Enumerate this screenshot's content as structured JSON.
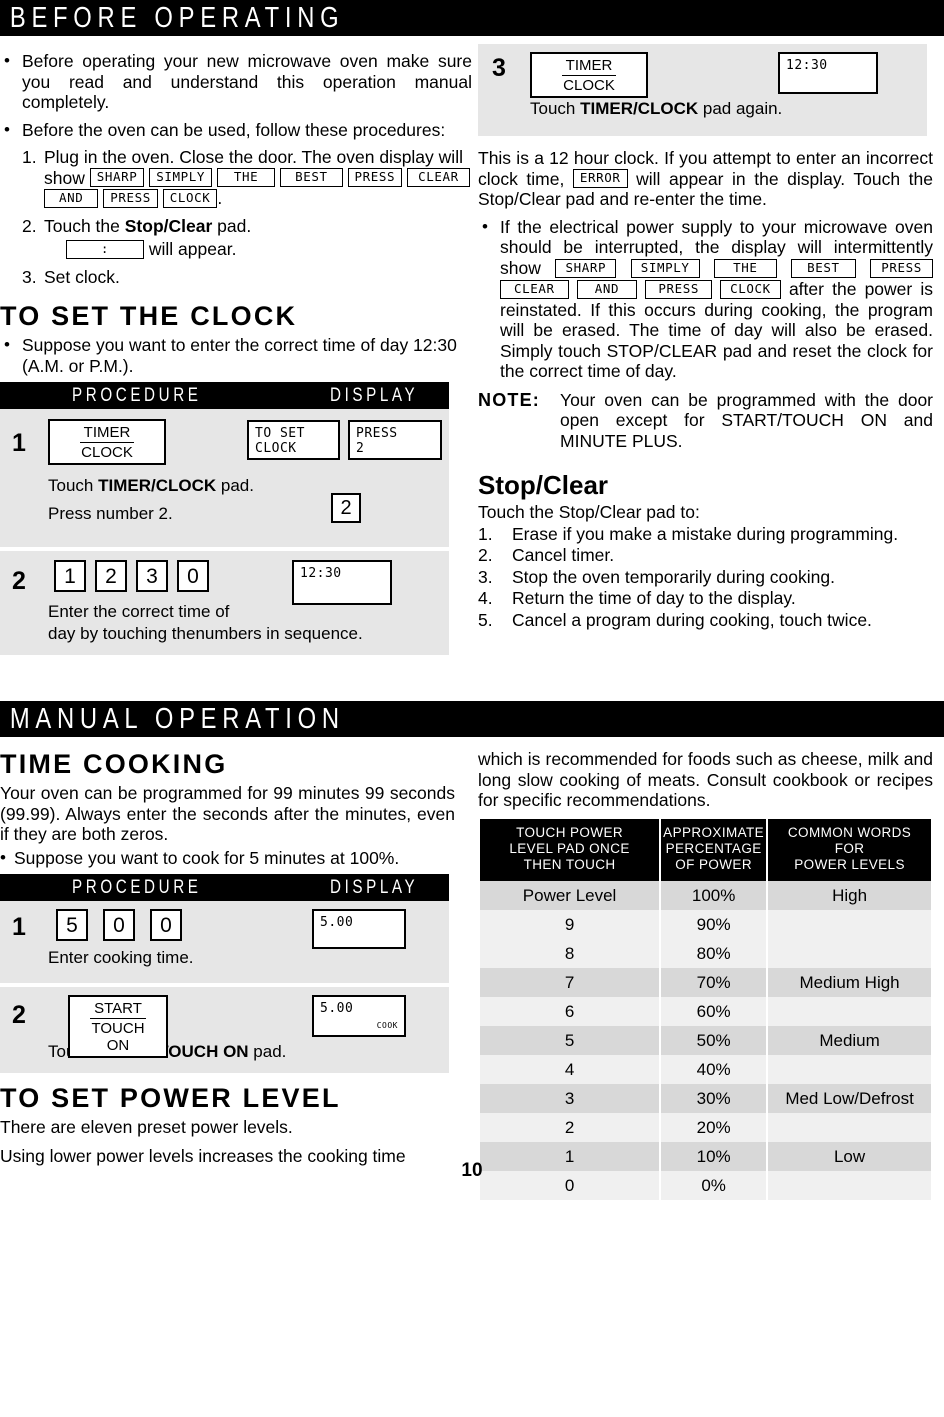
{
  "page": {
    "number": "10"
  },
  "sections": {
    "before_operating": {
      "banner": "BEFORE OPERATING"
    },
    "manual_operation": {
      "banner": "MANUAL OPERATION"
    }
  },
  "left": {
    "bullet1": "Before operating your new microwave oven make sure you read and understand this operation manual completely.",
    "bullet2": "Before the oven can be used, follow these procedures:",
    "step1_pre": "1.",
    "step1_a": "Plug in the oven. Close the door. The oven display",
    "step1_b": "will show",
    "step1_lcds": [
      "SHARP",
      "SIMPLY",
      "THE",
      "BEST",
      "PRESS",
      "CLEAR",
      "AND",
      "PRESS",
      "CLOCK"
    ],
    "step1_end": ".",
    "step2_n": "2.",
    "step2_a_pre": "Touch the ",
    "step2_a_bold": "Stop/Clear",
    "step2_a_post": " pad.",
    "step2_lcd": ":",
    "step2_b": "will appear.",
    "step3_n": "3.",
    "step3_t": "Set clock.",
    "clock_heading": "TO SET THE CLOCK",
    "clock_bullet": "Suppose you want to enter the correct time of day 12:30 (A.M. or P.M.).",
    "proc_header": {
      "procedure": "PROCEDURE",
      "display": "DISPLAY"
    },
    "clock_steps": [
      {
        "no": "1",
        "pad_top": "TIMER",
        "pad_bot": "CLOCK",
        "disp1_l1": "TO SET",
        "disp1_l2": "CLOCK",
        "disp2_l1": "PRESS",
        "disp2_l2": "2",
        "caption1_pre": "Touch ",
        "caption1_bold": "TIMER/CLOCK",
        "caption1_post": " pad.",
        "caption2": "Press number 2.",
        "numpad": "2"
      },
      {
        "no": "2",
        "keys": [
          "1",
          "2",
          "3",
          "0"
        ],
        "display": "12:30",
        "caption1": "Enter the correct time of",
        "caption2": "day by touching thenumbers in sequence."
      }
    ],
    "time_cooking_heading": "TIME COOKING",
    "time_cooking_p": "Your oven can be programmed for 99 minutes 99 seconds (99.99). Always enter the seconds after the minutes, even if they are both zeros.",
    "time_cooking_bullet": "Suppose you want to cook for 5 minutes at 100%.",
    "cook_steps": [
      {
        "no": "1",
        "keys": [
          "5",
          "0",
          "0"
        ],
        "display": "5.00",
        "caption": "Enter cooking time."
      },
      {
        "no": "2",
        "pad_top": "START",
        "pad_bot": "TOUCH ON",
        "display": "5.00",
        "display_sub": "COOK",
        "caption_pre": "Touch ",
        "caption_bold": "START/TOUCH ON",
        "caption_post": " pad."
      }
    ],
    "power_heading": "TO SET POWER LEVEL",
    "power_p1": "There are eleven preset power levels.",
    "power_p2": "Using lower power levels increases the cooking time"
  },
  "right": {
    "clock_step3": {
      "no": "3",
      "pad_top": "TIMER",
      "pad_bot": "CLOCK",
      "display": "12:30",
      "caption_pre": "Touch ",
      "caption_bold": "TIMER/CLOCK",
      "caption_post": " pad again."
    },
    "para1_a": "This is a 12 hour clock. If you attempt to enter an incorrect clock time,",
    "para1_lcd": "ERROR",
    "para1_b": "will appear in the display. Touch the Stop/Clear pad and re-enter the time.",
    "bullet_a": "If the electrical power supply to your microwave oven should be interrupted, the display will intermittently show",
    "bullet_lcds": [
      "SHARP",
      "SIMPLY",
      "THE",
      "BEST",
      "PRESS",
      "CLEAR",
      "AND",
      "PRESS",
      "CLOCK"
    ],
    "bullet_b": "after the power is reinstated. If this occurs during cooking, the program will be erased. The time of day will also be erased. Simply touch STOP/CLEAR pad and reset the clock for the correct time of day.",
    "note_label": "NOTE:",
    "note_body": "Your oven can be programmed with the door open except for START/TOUCH ON and MINUTE PLUS.",
    "stop_clear_heading": "Stop/Clear",
    "stop_clear_intro": "Touch the Stop/Clear pad to:",
    "stop_clear_items": [
      {
        "n": "1.",
        "t": "Erase if you make a mistake during programming."
      },
      {
        "n": "2.",
        "t": "Cancel timer."
      },
      {
        "n": "3.",
        "t": "Stop the oven temporarily during cooking."
      },
      {
        "n": "4.",
        "t": "Return the time of day to the display."
      },
      {
        "n": "5.",
        "t": "Cancel a program during cooking, touch twice."
      }
    ],
    "manual_intro": "which is recommended for foods such as cheese, milk and long slow cooking of meats. Consult cookbook or recipes for specific recommendations.",
    "power_table": {
      "headers": [
        "TOUCH POWER\nLEVEL PAD ONCE\nTHEN TOUCH",
        "APPROXIMATE\nPERCENTAGE\nOF POWER",
        "COMMON WORDS\nFOR\nPOWER LEVELS"
      ],
      "header_lines": [
        [
          "TOUCH POWER",
          "LEVEL PAD ONCE",
          "THEN TOUCH"
        ],
        [
          "APPROXIMATE",
          "PERCENTAGE",
          "OF POWER"
        ],
        [
          "COMMON WORDS",
          "FOR",
          "POWER LEVELS"
        ]
      ],
      "rows": [
        {
          "level": "Power Level",
          "pct": "100%",
          "word": "High",
          "shade": "A"
        },
        {
          "level": "9",
          "pct": "90%",
          "word": "",
          "shade": "B"
        },
        {
          "level": "8",
          "pct": "80%",
          "word": "",
          "shade": "B"
        },
        {
          "level": "7",
          "pct": "70%",
          "word": "Medium High",
          "shade": "A"
        },
        {
          "level": "6",
          "pct": "60%",
          "word": "",
          "shade": "B"
        },
        {
          "level": "5",
          "pct": "50%",
          "word": "Medium",
          "shade": "A"
        },
        {
          "level": "4",
          "pct": "40%",
          "word": "",
          "shade": "B"
        },
        {
          "level": "3",
          "pct": "30%",
          "word": "Med Low/Defrost",
          "shade": "A"
        },
        {
          "level": "2",
          "pct": "20%",
          "word": "",
          "shade": "B"
        },
        {
          "level": "1",
          "pct": "10%",
          "word": "Low",
          "shade": "A"
        },
        {
          "level": "0",
          "pct": "0%",
          "word": "",
          "shade": "B"
        }
      ]
    }
  }
}
